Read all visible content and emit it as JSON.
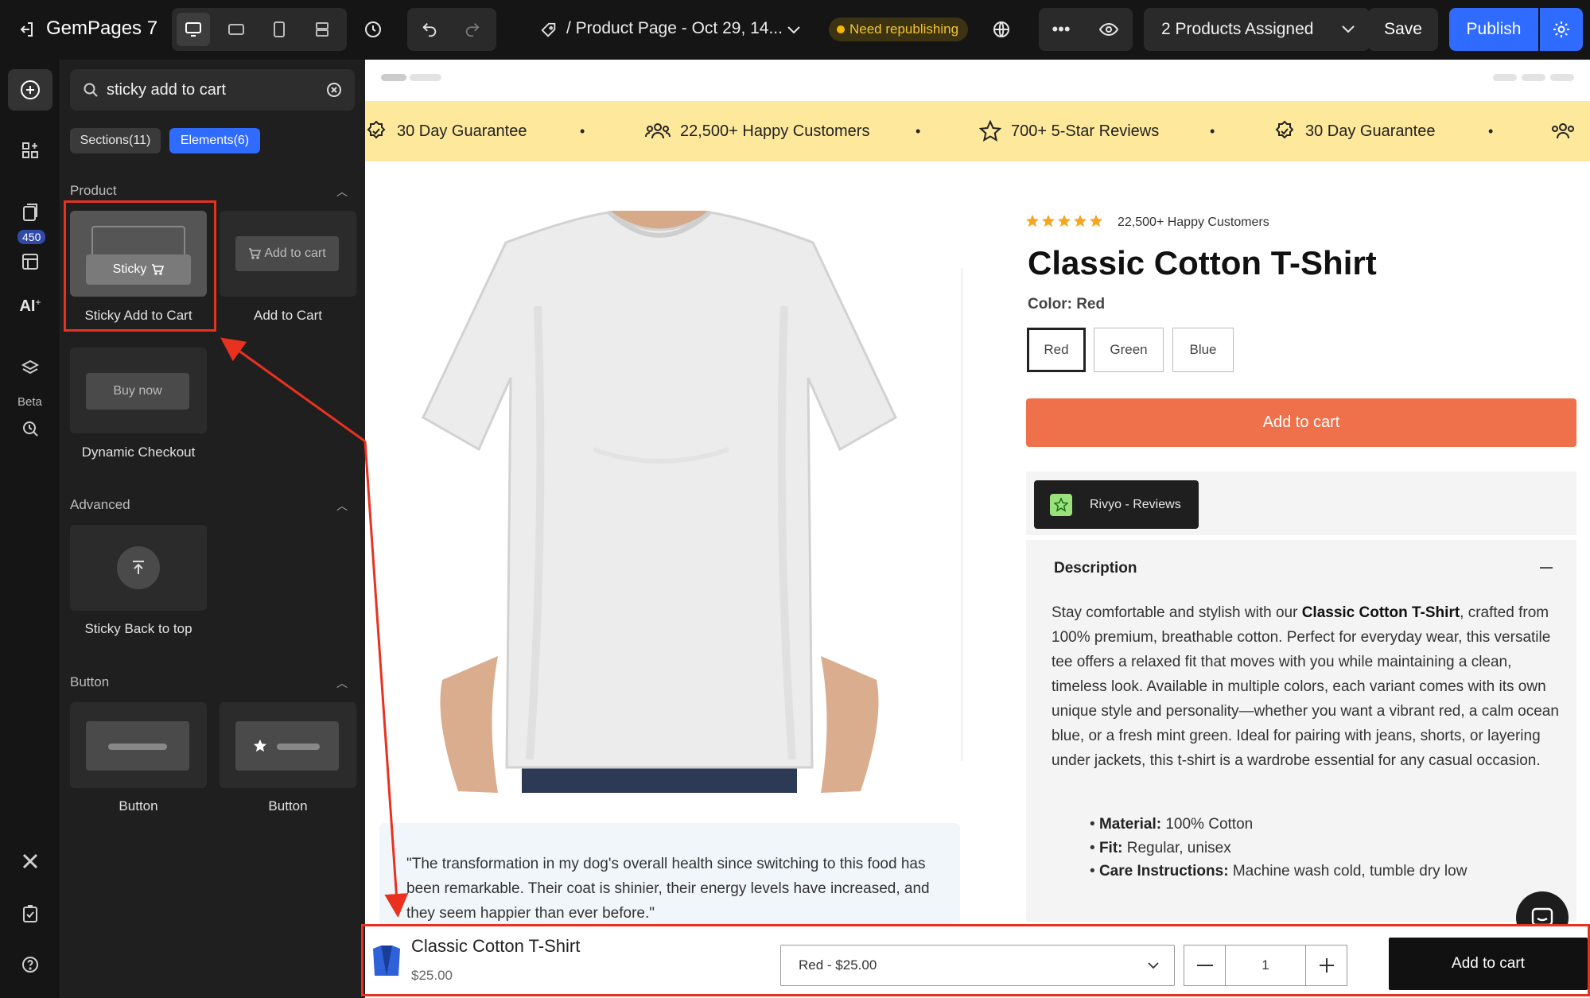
{
  "topbar": {
    "brand": "GemPages",
    "brand_version": "7",
    "page_title": "/ Product Page - Oct 29, 14...",
    "status_badge": "Need republishing",
    "products_assigned": "2 Products Assigned",
    "save_label": "Save",
    "publish_label": "Publish"
  },
  "rail": {
    "badge_count": "450",
    "ai_label": "AI",
    "beta_label": "Beta"
  },
  "panel": {
    "search_value": "sticky add to cart",
    "tabs": [
      {
        "label": "Sections(11)"
      },
      {
        "label": "Elements(6)"
      }
    ],
    "sections": {
      "product": "Product",
      "advanced": "Advanced",
      "button": "Button"
    },
    "elements": {
      "sticky_atc_thumb": "Sticky",
      "sticky_atc": "Sticky Add to Cart",
      "atc_thumb": "Add to cart",
      "atc": "Add to Cart",
      "buy_now_thumb": "Buy now",
      "dynamic_checkout": "Dynamic Checkout",
      "sticky_back": "Sticky Back to top",
      "button1": "Button",
      "button2": "Button"
    }
  },
  "ticker": [
    "30 Day Guarantee",
    "22,500+ Happy Customers",
    "700+ 5-Star Reviews",
    "30 Day Guarantee"
  ],
  "product": {
    "rating_text": "22,500+ Happy Customers",
    "title": "Classic Cotton T-Shirt",
    "color_label": "Color: Red",
    "swatches": [
      "Red",
      "Green",
      "Blue"
    ],
    "add_to_cart": "Add to cart",
    "reviews_app": "Rivyo - Reviews",
    "description_title": "Description",
    "desc_intro": "Stay comfortable and stylish with our ",
    "desc_bold": "Classic Cotton T-Shirt",
    "desc_rest": ", crafted from 100% premium, breathable cotton. Perfect for everyday wear, this versatile tee offers a relaxed fit that moves with you while maintaining a clean, timeless look. Available in multiple colors, each variant comes with its own unique style and personality—whether you want a vibrant red, a calm ocean blue, or a fresh mint green. Ideal for pairing with jeans, shorts, or layering under jackets, this t-shirt is a wardrobe essential for any casual occasion.",
    "bullets": [
      {
        "label": "Material:",
        "value": "100% Cotton"
      },
      {
        "label": "Fit:",
        "value": "Regular, unisex"
      },
      {
        "label": "Care Instructions:",
        "value": "Machine wash cold, tumble dry low"
      }
    ],
    "testimonial": "\"The transformation in my dog's overall health since switching to this food has been remarkable. Their coat is shinier, their energy levels have increased, and they seem happier than ever before.\""
  },
  "sticky": {
    "title": "Classic Cotton T-Shirt",
    "price": "$25.00",
    "variant": "Red - $25.00",
    "qty": "1",
    "add_to_cart": "Add to cart"
  },
  "colors": {
    "accent": "#2f6bff",
    "cta": "#ef714b",
    "ticker_bg": "#fde89b",
    "highlight": "#e8321f"
  }
}
